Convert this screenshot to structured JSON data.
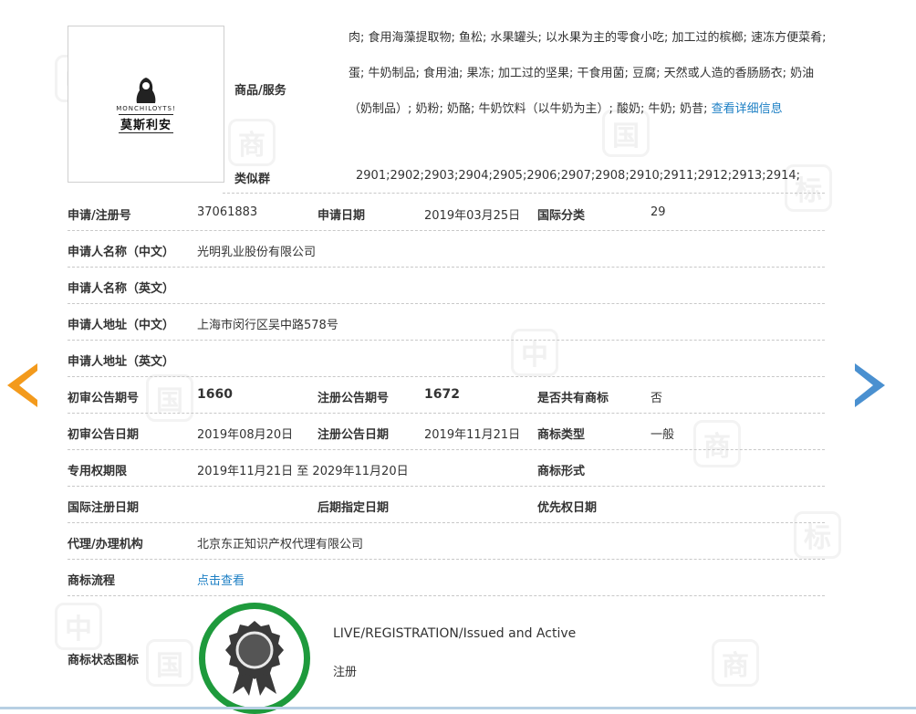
{
  "logo": {
    "arc_text": "MONCHILOYTS!",
    "brand_text": "莫斯利安"
  },
  "goods": {
    "label": "商品/服务",
    "text": "肉; 食用海藻提取物; 鱼松; 水果罐头; 以水果为主的零食小吃; 加工过的槟榔; 速冻方便菜肴; 蛋; 牛奶制品; 食用油; 果冻; 加工过的坚果; 干食用菌; 豆腐; 天然或人造的香肠肠衣; 奶油（奶制品）; 奶粉; 奶酪; 牛奶饮料（以牛奶为主）; 酸奶; 牛奶; 奶昔;",
    "more_link": "查看详细信息"
  },
  "similar_group": {
    "label": "类似群",
    "value": "2901;2902;2903;2904;2905;2906;2907;2908;2910;2911;2912;2913;2914;"
  },
  "rows": {
    "reg": {
      "label": "申请/注册号",
      "value": "37061883",
      "date_label": "申请日期",
      "date_value": "2019年03月25日",
      "class_label": "国际分类",
      "class_value": "29"
    },
    "applicant_cn": {
      "label": "申请人名称（中文）",
      "value": "光明乳业股份有限公司"
    },
    "applicant_en": {
      "label": "申请人名称（英文）",
      "value": ""
    },
    "address_cn": {
      "label": "申请人地址（中文）",
      "value": "上海市闵行区吴中路578号"
    },
    "address_en": {
      "label": "申请人地址（英文）",
      "value": ""
    },
    "pub_no": {
      "label": "初审公告期号",
      "value": "1660",
      "reg_label": "注册公告期号",
      "reg_value": "1672",
      "shared_label": "是否共有商标",
      "shared_value": "否"
    },
    "pub_date": {
      "label": "初审公告日期",
      "value": "2019年08月20日",
      "reg_label": "注册公告日期",
      "reg_value": "2019年11月21日",
      "type_label": "商标类型",
      "type_value": "一般"
    },
    "period": {
      "label": "专用权期限",
      "value": "2019年11月21日 至 2029年11月20日",
      "form_label": "商标形式",
      "form_value": ""
    },
    "intl": {
      "label": "国际注册日期",
      "value": "",
      "later_label": "后期指定日期",
      "later_value": "",
      "priority_label": "优先权日期",
      "priority_value": ""
    },
    "agent": {
      "label": "代理/办理机构",
      "value": "北京东正知识产权代理有限公司"
    },
    "flow": {
      "label": "商标流程",
      "link": "点击查看"
    }
  },
  "status": {
    "label": "商标状态图标",
    "english": "LIVE/REGISTRATION/Issued and Active",
    "chinese": "注册"
  },
  "colors": {
    "seal_ring": "#1e9a3c",
    "seal_medal": "#3a3a3a",
    "link": "#1c7fc4",
    "prev_arrow": "#f39a1c",
    "next_arrow": "#4a90d0"
  },
  "watermark": {
    "glyphs": [
      "中",
      "国",
      "商",
      "标"
    ]
  }
}
